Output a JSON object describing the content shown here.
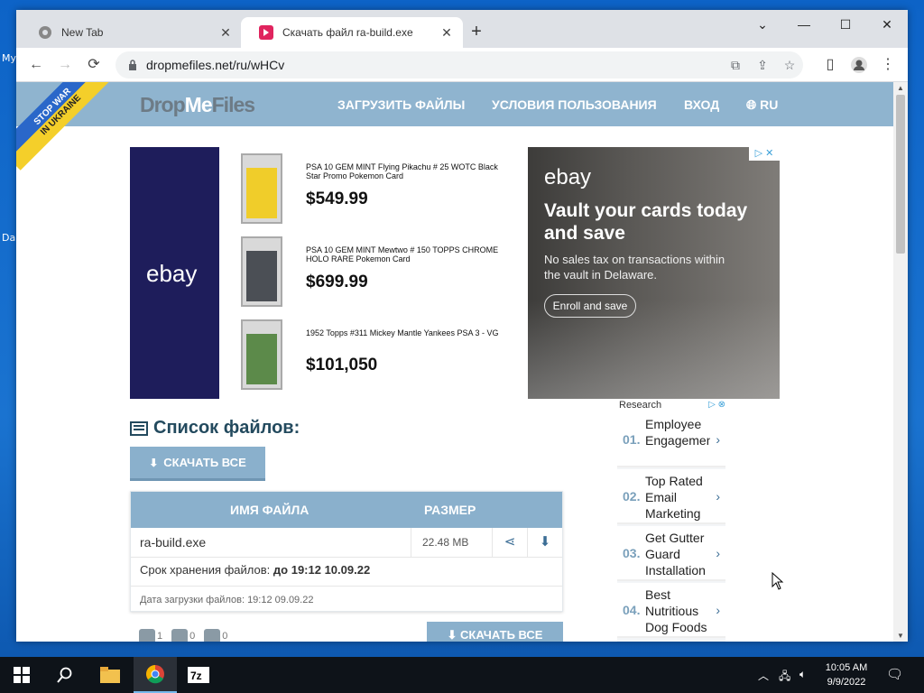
{
  "desktop": {
    "labels": [
      "My",
      "Da"
    ]
  },
  "browser": {
    "tabs": [
      {
        "title": "New Tab"
      },
      {
        "title": "Скачать файл ra-build.exe"
      }
    ],
    "new_tab": "+",
    "window_controls": {
      "chevron": "⌄",
      "minimize": "—",
      "maximize": "☐",
      "close": "✕"
    },
    "nav": {
      "back": "←",
      "forward": "→",
      "reload": "⟳"
    },
    "url": "dropmefiles.net/ru/wHCv"
  },
  "site": {
    "logo_a": "Drop",
    "logo_b": "Me",
    "logo_c": "Files",
    "ribbon_1": "STOP WAR",
    "ribbon_2": "IN UKRAINE",
    "nav": [
      "ЗАГРУЗИТЬ ФАЙЛЫ",
      "УСЛОВИЯ ПОЛЬЗОВАНИЯ",
      "ВХОД",
      "RU"
    ]
  },
  "ad": {
    "brand": "ebay",
    "items": [
      {
        "name": "PSA 10 GEM MINT Flying Pikachu # 25 WOTC Black Star Promo Pokemon Card",
        "price": "$549.99",
        "color": "#f0cd2a"
      },
      {
        "name": "PSA 10 GEM MINT Mewtwo # 150 TOPPS CHROME HOLO RARE Pokemon Card",
        "price": "$699.99",
        "color": "#4b4f55"
      },
      {
        "name": "1952 Topps #311 Mickey Mantle Yankees PSA 3 - VG",
        "price": "$101,050",
        "color": "#5c8a4a"
      }
    ],
    "headline": "Vault your cards today and save",
    "subline": "No sales tax on transactions within the vault in Delaware.",
    "cta": "Enroll and save",
    "close_marks": "▷ ✕"
  },
  "files": {
    "heading": "Список файлов:",
    "download_all": "СКАЧАТЬ ВСЕ",
    "col_name": "ИМЯ ФАЙЛА",
    "col_size": "РАЗМЕР",
    "rows": [
      {
        "name": "ra-build.exe",
        "size": "22.48 MB"
      }
    ],
    "expire_prefix": "Срок хранения файлов:",
    "expire_value": "до 19:12 10.09.22",
    "uploaded": "Дата загрузки файлов: 19:12 09.09.22",
    "stats": [
      "1",
      "0",
      "0"
    ]
  },
  "research": {
    "title": "Research",
    "items": [
      {
        "num": "01.",
        "text": "Employee Engagement"
      },
      {
        "num": "02.",
        "text": "Top Rated Email Marketing"
      },
      {
        "num": "03.",
        "text": "Get Gutter Guard Installation"
      },
      {
        "num": "04.",
        "text": "Best Nutritious Dog Foods"
      }
    ]
  },
  "taskbar": {
    "time": "10:05 AM",
    "date": "9/9/2022"
  },
  "colors": {
    "site_header": "#8fb4cf",
    "accent": "#8ab0cc"
  }
}
